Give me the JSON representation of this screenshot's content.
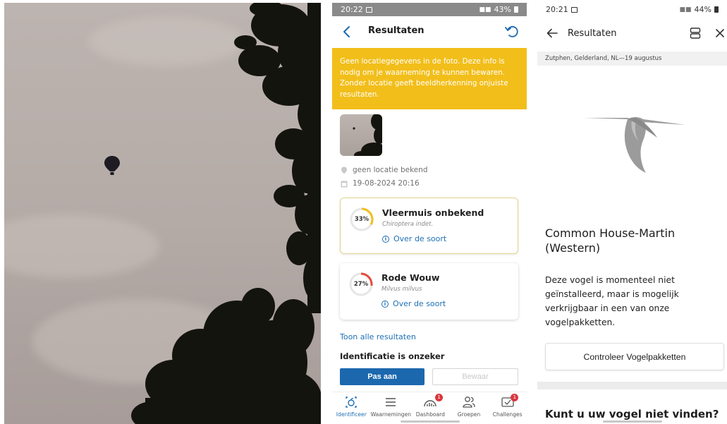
{
  "left_photo": {
    "icon": "hot-air-balloon"
  },
  "middle_app": {
    "status": {
      "time": "20:22",
      "battery": "43%"
    },
    "header": {
      "title": "Resultaten"
    },
    "warning": "Geen locatiegegevens in de foto. Deze info is nodig om je waarneming te kunnen bewaren. Zonder locatie geeft beeldherkenning onjuiste resultaten.",
    "meta": {
      "location": "geen locatie bekend",
      "datetime": "19-08-2024 20:16"
    },
    "results": [
      {
        "percent_label": "33%",
        "percent": 33,
        "gauge_color": "#f2be1a",
        "name": "Vleermuis onbekend",
        "scientific": "Chiroptera indet.",
        "info_link": "Over de soort"
      },
      {
        "percent_label": "27%",
        "percent": 27,
        "gauge_color": "#e24b3b",
        "name": "Rode Wouw",
        "scientific": "Milvus milvus",
        "info_link": "Over de soort"
      }
    ],
    "show_all": "Toon alle resultaten",
    "uncertain_heading": "Identificatie is onzeker",
    "buttons": {
      "adjust": "Pas aan",
      "save": "Bewaar"
    },
    "nav": [
      {
        "label": "Identificeer",
        "icon": "identify-icon",
        "active": true
      },
      {
        "label": "Waarnemingen",
        "icon": "list-icon"
      },
      {
        "label": "Dashboard",
        "icon": "dashboard-icon",
        "badge": "1"
      },
      {
        "label": "Groepen",
        "icon": "groups-icon"
      },
      {
        "label": "Challenges",
        "icon": "challenges-icon",
        "badge": "1"
      }
    ],
    "accent_color": "#1c68ae",
    "warning_color": "#f2be1a"
  },
  "right_app": {
    "status": {
      "time": "20:21",
      "battery": "44%"
    },
    "header": {
      "title": "Resultaten"
    },
    "location_line": "Zutphen, Gelderland, NL—19 augustus",
    "bird_name_line1": "Common House-Martin",
    "bird_name_line2": "(Western)",
    "description": "Deze vogel is momenteel niet geïnstalleerd, maar is mogelijk verkrijgbaar in een van onze vogelpakketten.",
    "check_button": "Controleer Vogelpakketten",
    "cant_find": "Kunt u uw vogel niet vinden?"
  }
}
